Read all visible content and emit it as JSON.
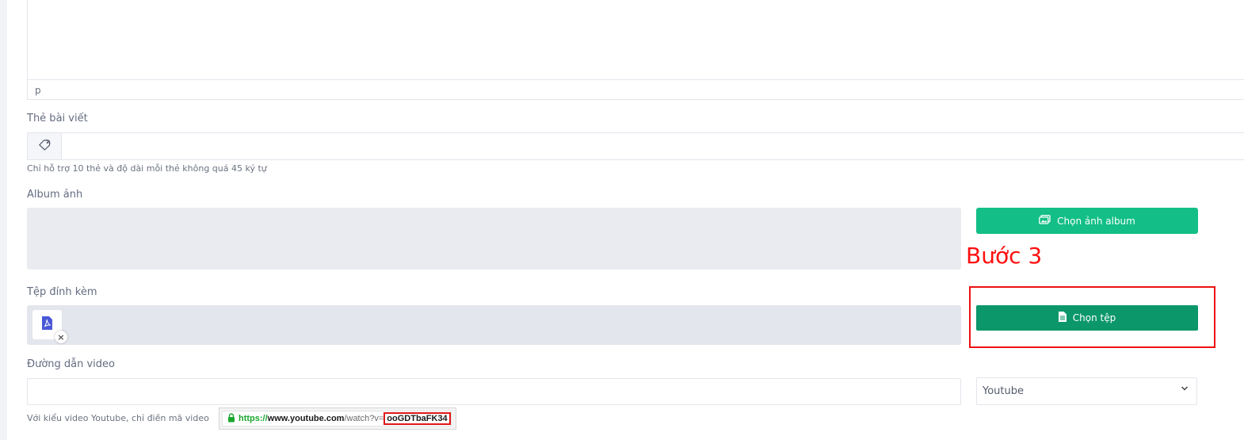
{
  "editor": {
    "status_path": "p"
  },
  "tags": {
    "label": "Thẻ bài viết",
    "hint": "Chỉ hỗ trợ 10 thẻ và độ dài mỗi thẻ không quá 45 ký tự",
    "icon": "tag-icon"
  },
  "album": {
    "label": "Album ảnh",
    "button_label": "Chọn ảnh album",
    "button_icon": "images-icon",
    "button_color": "#13bf86"
  },
  "annotation": {
    "step_text": "Bước 3",
    "color": "#ff1010"
  },
  "attachment": {
    "label": "Tệp đính kèm",
    "button_label": "Chọn tệp",
    "button_icon": "file-icon",
    "button_color": "#0b9769",
    "file_icon": "pdf-file-icon",
    "remove_icon": "close-icon",
    "remove_symbol": "×"
  },
  "video": {
    "label": "Đường dẫn video",
    "url_value": "",
    "select_value": "Youtube",
    "hint": "Với kiểu video Youtube, chỉ điền mã video",
    "example_url": {
      "scheme": "https://",
      "host": "www.youtube.com",
      "path": "/watch?v=",
      "code": "ooGDTbaFK34",
      "icon": "lock-icon"
    }
  }
}
